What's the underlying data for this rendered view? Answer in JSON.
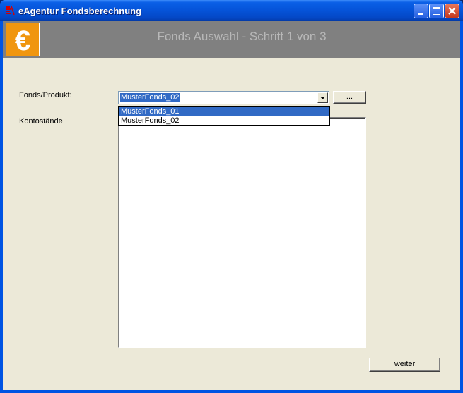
{
  "window": {
    "title": "eAgentur Fondsberechnung",
    "titlebar_color": "#0553d8"
  },
  "titlebar_buttons": [
    "minimize-icon",
    "maximize-icon",
    "close-icon"
  ],
  "banner": {
    "logo_icon": "euro-icon",
    "logo_glyph": "€",
    "title": "Fonds Auswahl - Schritt 1 von 3",
    "background": "#808080",
    "logo_color": "#f0960f"
  },
  "form": {
    "fonds_label": "Fonds/Produkt:",
    "fonds_value": "MusterFonds_02",
    "browse_button": "...",
    "kontostaende_label": "Kontostände",
    "dropdown_options": [
      "MusterFonds_01",
      "MusterFonds_02"
    ],
    "dropdown_highlighted": "MusterFonds_01"
  },
  "footer": {
    "next_button": "weiter"
  }
}
